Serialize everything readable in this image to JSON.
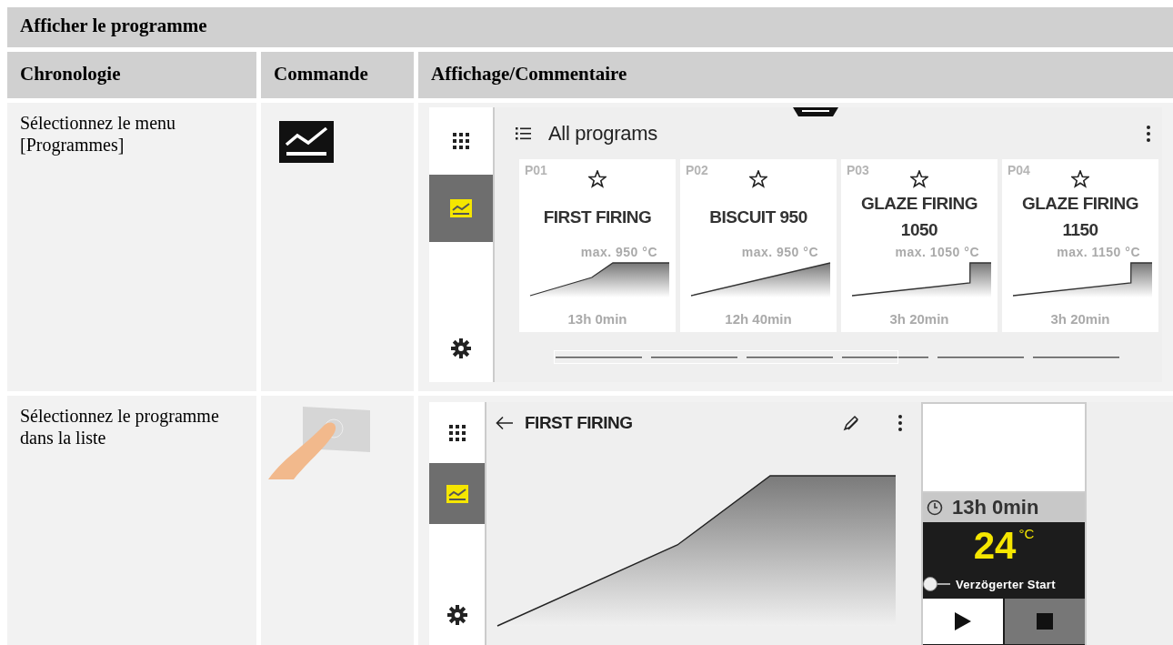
{
  "title": "Afficher le programme",
  "columns": [
    "Chronologie",
    "Commande",
    "Affichage/Commentaire"
  ],
  "rows": [
    {
      "step": "Sélectionnez le menu [Programmes]",
      "command": {
        "kind": "chart-key"
      },
      "display": {
        "kind": "list",
        "nav": [
          {
            "kind": "apps",
            "selected": false
          },
          {
            "kind": "programs",
            "selected": true
          },
          {
            "kind": "settings",
            "selected": false
          }
        ],
        "heading": "All programs",
        "programs": [
          {
            "number": "P01",
            "name": "FIRST FIRING",
            "max": "max. 950 °C",
            "duration": "13h 0min",
            "kind": "ramp-hold"
          },
          {
            "number": "P02",
            "name": "BISCUIT 950",
            "max": "max. 950 °C",
            "duration": "12h 40min",
            "kind": "ramp"
          },
          {
            "number": "P03",
            "name": "GLAZE FIRING 1050",
            "max": "max. 1050 °C",
            "duration": "3h 20min",
            "kind": "ramp-step"
          },
          {
            "number": "P04",
            "name": "GLAZE FIRING 1150",
            "max": "max. 1150 °C",
            "duration": "3h 20min",
            "kind": "ramp-step"
          }
        ]
      }
    },
    {
      "step": "Sélectionnez le programme dans la liste",
      "command": {
        "kind": "tap"
      },
      "display": {
        "kind": "detail",
        "nav": [
          {
            "kind": "apps",
            "selected": false
          },
          {
            "kind": "programs",
            "selected": true
          },
          {
            "kind": "settings",
            "selected": false
          }
        ],
        "heading": "FIRST FIRING",
        "duration": "13h 0min",
        "temperature": "24",
        "unit": "°C",
        "delayed_start": {
          "label": "Verzögerter Start",
          "on": false
        }
      }
    }
  ]
}
